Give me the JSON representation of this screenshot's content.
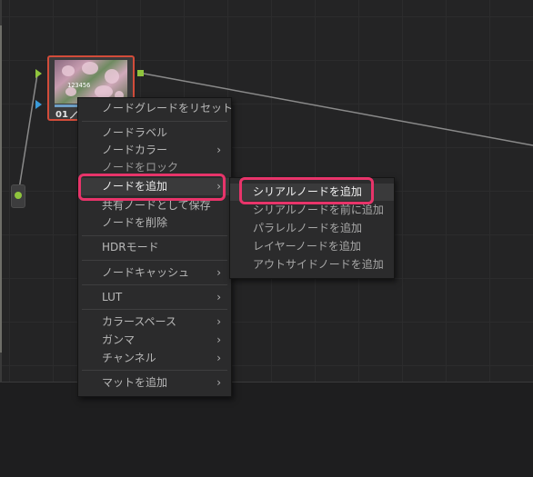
{
  "node": {
    "number": "01",
    "thumbnail_text": "123456"
  },
  "colors": {
    "node_border": "#d24c3a",
    "port_green": "#8fc43d",
    "port_blue": "#3a9ad9",
    "highlight": "#e8346a",
    "menu_bg": "#2b2b2c"
  },
  "context_menu": {
    "items": [
      {
        "label": "ノードグレードをリセット"
      },
      {
        "label": "ノードラベル"
      },
      {
        "label": "ノードカラー",
        "arrow": "›"
      },
      {
        "label": "ノードをロック"
      },
      {
        "label": "ノードを追加",
        "arrow": "›"
      },
      {
        "label": "共有ノードとして保存"
      },
      {
        "label": "ノードを削除"
      },
      {
        "label": "HDRモード"
      },
      {
        "label": "ノードキャッシュ",
        "arrow": "›"
      },
      {
        "label": "LUT",
        "arrow": "›"
      },
      {
        "label": "カラースペース",
        "arrow": "›"
      },
      {
        "label": "ガンマ",
        "arrow": "›"
      },
      {
        "label": "チャンネル",
        "arrow": "›"
      },
      {
        "label": "マットを追加",
        "arrow": "›"
      }
    ]
  },
  "submenu": {
    "items": [
      {
        "label": "シリアルノードを追加"
      },
      {
        "label": "シリアルノードを前に追加"
      },
      {
        "label": "パラレルノードを追加"
      },
      {
        "label": "レイヤーノードを追加"
      },
      {
        "label": "アウトサイドノードを追加"
      }
    ]
  }
}
